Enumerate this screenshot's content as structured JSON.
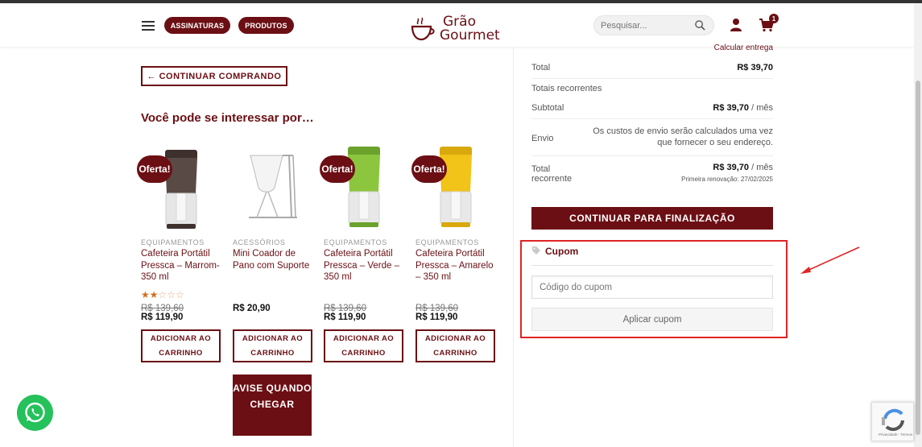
{
  "header": {
    "nav_pills": [
      "ASSINATURAS",
      "PRODUTOS"
    ],
    "logo": {
      "line1": "Grão",
      "line2": "Gourmet"
    },
    "search_placeholder": "Pesquisar...",
    "cart_count": "1"
  },
  "main": {
    "continue_label": "← CONTINUAR COMPRANDO",
    "section_title": "Você pode se interessar por…",
    "sale_badge": "Oferta!",
    "add_label": "ADICIONAR AO CARRINHO",
    "products": [
      {
        "category": "EQUIPAMENTOS",
        "name": "Cafeteira Portátil Pressca – Marrom-350 ml",
        "old_price": "R$ 139,60",
        "price": "R$ 119,90",
        "on_sale": true,
        "rating": 2,
        "color": "#5a4a45"
      },
      {
        "category": "ACESSÓRIOS",
        "name": "Mini Coador de Pano com Suporte",
        "old_price": "",
        "price": "R$ 20,90",
        "on_sale": false,
        "color": "#ddd"
      },
      {
        "category": "EQUIPAMENTOS",
        "name": "Cafeteira Portátil Pressca – Verde – 350 ml",
        "old_price": "R$ 139,60",
        "price": "R$ 119,90",
        "on_sale": true,
        "color": "#8cc63f"
      },
      {
        "category": "EQUIPAMENTOS",
        "name": "Cafeteira Portátil Pressca – Amarelo – 350 ml",
        "old_price": "R$ 139,60",
        "price": "R$ 119,90",
        "on_sale": true,
        "color": "#f2c318"
      }
    ],
    "notify_label": "AVISE QUANDO CHEGAR"
  },
  "totals": {
    "calc_link": "Calcular entrega",
    "total_label": "Total",
    "total_value": "R$ 39,70",
    "recurring_heading": "Totais recorrentes",
    "subtotal_label": "Subtotal",
    "subtotal_value": "R$ 39,70",
    "per_month": " / mês",
    "shipping_label": "Envio",
    "shipping_text": "Os custos de envio serão calculados uma vez que fornecer o seu endereço.",
    "recurring_total_label": "Total recorrente",
    "recurring_total_value": "R$ 39,70",
    "renewal_text": "Primeira renovação: 27/02/2025",
    "finalize_label": "CONTINUAR PARA FINALIZAÇÃO"
  },
  "coupon": {
    "title": "Cupom",
    "placeholder": "Código do cupom",
    "apply_label": "Aplicar cupom"
  },
  "recaptcha_text": "Privacidade - Termos",
  "colors": {
    "brand": "#6b0f14",
    "highlight": "#e02424",
    "whatsapp": "#25c15b"
  }
}
